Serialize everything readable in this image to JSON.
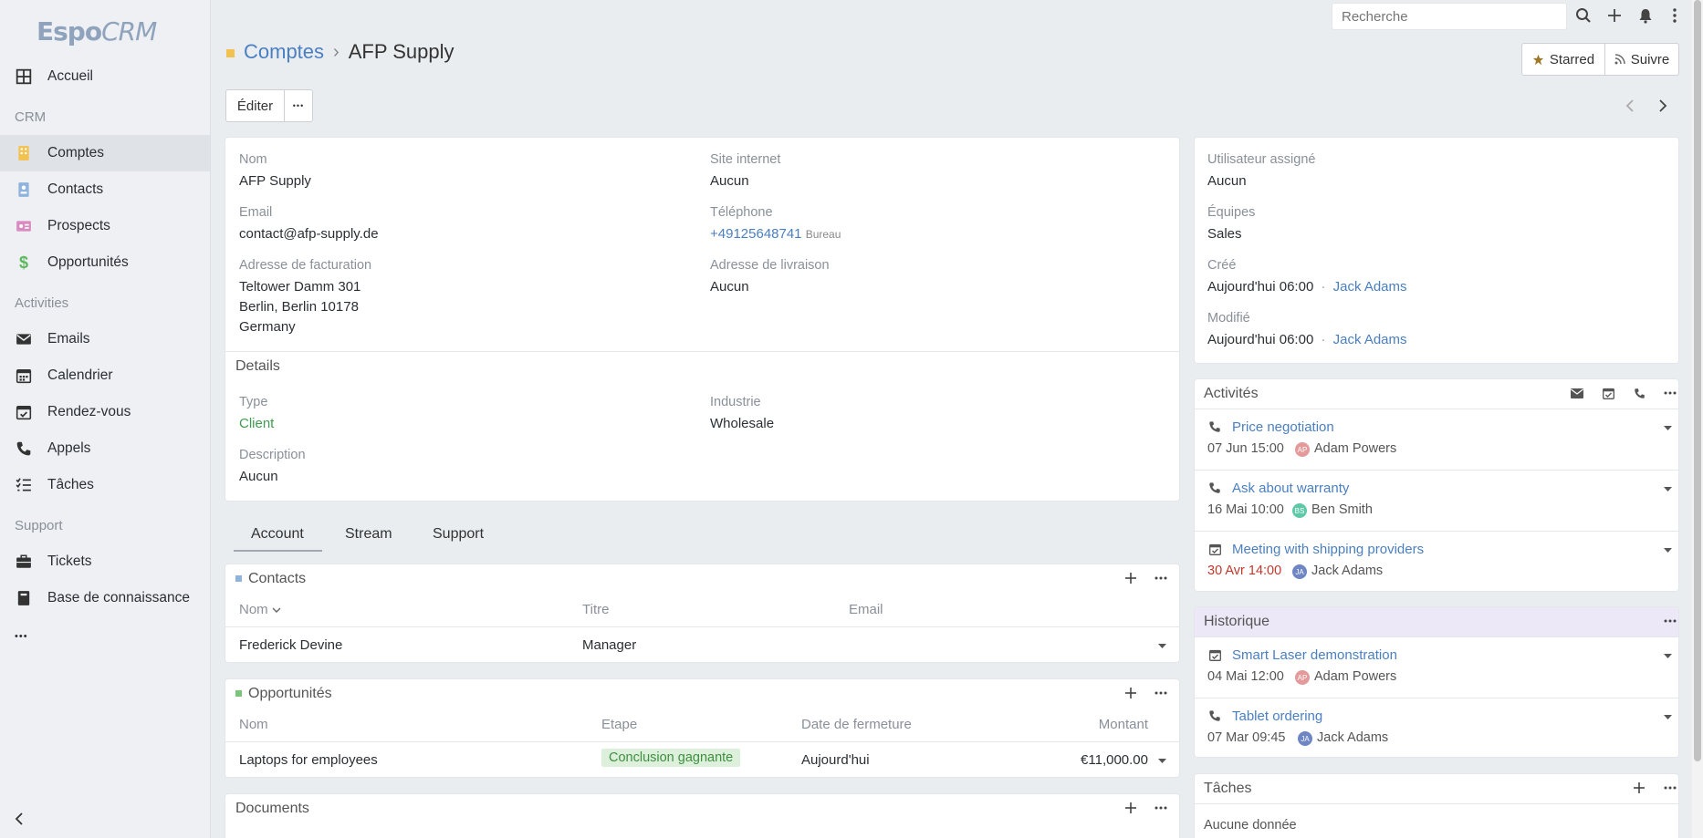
{
  "app": {
    "logo_main": "Espo",
    "logo_sub": "CRM"
  },
  "search": {
    "placeholder": "Recherche"
  },
  "sidebar": {
    "home": "Accueil",
    "group_crm": "CRM",
    "group_activities": "Activities",
    "group_support": "Support",
    "items": {
      "comptes": "Comptes",
      "contacts": "Contacts",
      "prospects": "Prospects",
      "opportunites": "Opportunités",
      "emails": "Emails",
      "calendrier": "Calendrier",
      "rendezvous": "Rendez-vous",
      "appels": "Appels",
      "taches": "Tâches",
      "tickets": "Tickets",
      "kb": "Base de connaissance"
    },
    "more": "•••"
  },
  "header": {
    "crumb_parent": "Comptes",
    "crumb_separator": "›",
    "crumb_current": "AFP Supply",
    "starred_label": "Starred",
    "follow_label": "Suivre",
    "edit_label": "Éditer",
    "more_label": "•••"
  },
  "overview": {
    "nom_label": "Nom",
    "nom_value": "AFP Supply",
    "site_label": "Site internet",
    "site_value": "Aucun",
    "email_label": "Email",
    "email_value": "contact@afp-supply.de",
    "phone_label": "Téléphone",
    "phone_value": "+49125648741",
    "phone_type": "Bureau",
    "billing_label": "Adresse de facturation",
    "billing_line1": "Teltower Damm 301",
    "billing_line2": "Berlin, Berlin 10178",
    "billing_line3": "Germany",
    "shipping_label": "Adresse de livraison",
    "shipping_value": "Aucun"
  },
  "details": {
    "title": "Details",
    "type_label": "Type",
    "type_value": "Client",
    "industry_label": "Industrie",
    "industry_value": "Wholesale",
    "desc_label": "Description",
    "desc_value": "Aucun"
  },
  "side": {
    "assigned_label": "Utilisateur assigné",
    "assigned_value": "Aucun",
    "teams_label": "Équipes",
    "teams_value": "Sales",
    "created_label": "Créé",
    "created_time": "Aujourd'hui 06:00",
    "created_by": "Jack Adams",
    "modified_label": "Modifié",
    "modified_time": "Aujourd'hui 06:00",
    "modified_by": "Jack Adams",
    "dot": "·"
  },
  "tabs": {
    "account": "Account",
    "stream": "Stream",
    "support": "Support"
  },
  "contacts_panel": {
    "title": "Contacts",
    "col_nom": "Nom",
    "col_titre": "Titre",
    "col_email": "Email",
    "rows": [
      {
        "nom": "Frederick Devine",
        "titre": "Manager",
        "email": ""
      }
    ]
  },
  "opps_panel": {
    "title": "Opportunités",
    "col_nom": "Nom",
    "col_etape": "Etape",
    "col_date": "Date de fermeture",
    "col_montant": "Montant",
    "rows": [
      {
        "nom": "Laptops for employees",
        "etape": "Conclusion gagnante",
        "date": "Aujourd'hui",
        "montant": "€11,000.00"
      }
    ]
  },
  "docs_panel": {
    "title": "Documents"
  },
  "activities": {
    "title": "Activités",
    "items": [
      {
        "title": "Price negotiation",
        "date": "07 Jun 15:00",
        "initials": "AP",
        "user": "Adam Powers"
      },
      {
        "title": "Ask about warranty",
        "date": "16 Mai 10:00",
        "initials": "BS",
        "user": "Ben Smith"
      },
      {
        "title": "Meeting with shipping providers",
        "date": "30 Avr 14:00",
        "initials": "JA",
        "user": "Jack Adams"
      }
    ]
  },
  "history": {
    "title": "Historique",
    "items": [
      {
        "title": "Smart Laser demonstration",
        "date": "04 Mai 12:00",
        "initials": "AP",
        "user": "Adam Powers"
      },
      {
        "title": "Tablet ordering",
        "date": "07 Mar 09:45",
        "initials": "JA",
        "user": "Jack Adams"
      }
    ]
  },
  "tasks": {
    "title": "Tâches",
    "empty": "Aucune donnée"
  },
  "colors": {
    "accent": "#4a7fc1",
    "client_green": "#3f9b4f",
    "overdue_red": "#c0392b",
    "history_bg": "#ece8f7"
  }
}
